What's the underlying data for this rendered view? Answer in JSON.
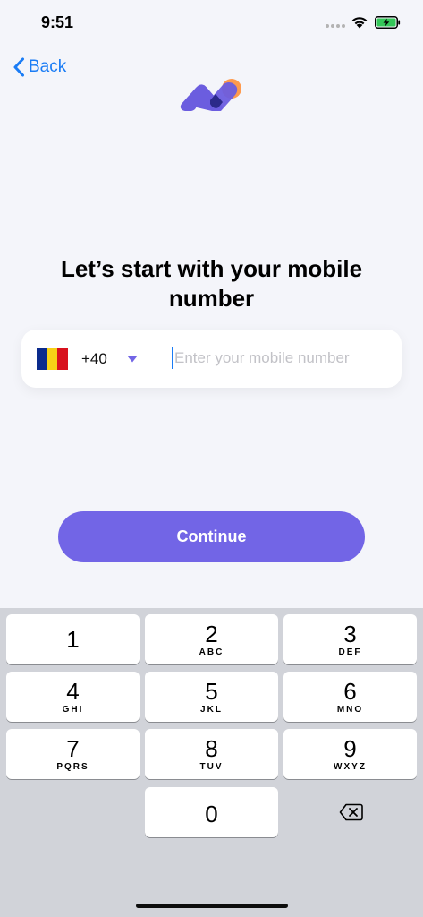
{
  "status_bar": {
    "time": "9:51"
  },
  "nav": {
    "back_label": "Back"
  },
  "title": "Let’s start with your mobile number",
  "phone": {
    "country_flag": "romania-flag",
    "flag_colors": [
      "#0b2a8c",
      "#f7d116",
      "#d8111d"
    ],
    "dial_code": "+40",
    "placeholder": "Enter your mobile number",
    "value": ""
  },
  "continue_label": "Continue",
  "colors": {
    "accent": "#7265e6",
    "link": "#1a7cf5",
    "logo_orange": "#ff9a4d",
    "logo_purple": "#6b5ddf",
    "logo_navy": "#2b2a8a"
  },
  "keyboard": {
    "keys": [
      {
        "digit": "1",
        "letters": ""
      },
      {
        "digit": "2",
        "letters": "ABC"
      },
      {
        "digit": "3",
        "letters": "DEF"
      },
      {
        "digit": "4",
        "letters": "GHI"
      },
      {
        "digit": "5",
        "letters": "JKL"
      },
      {
        "digit": "6",
        "letters": "MNO"
      },
      {
        "digit": "7",
        "letters": "PQRS"
      },
      {
        "digit": "8",
        "letters": "TUV"
      },
      {
        "digit": "9",
        "letters": "WXYZ"
      },
      {
        "digit": "0",
        "letters": ""
      }
    ],
    "delete_icon": "backspace-icon"
  }
}
